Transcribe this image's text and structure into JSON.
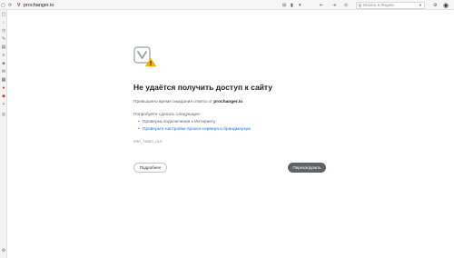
{
  "toolbar": {
    "url": "prochanger.io",
    "search_placeholder": "Искать в Яндекс"
  },
  "error": {
    "title": "Не удаётся получить доступ к сайту",
    "timeout_prefix": "Превышено время ожидания ответа от ",
    "host": "prochanger.io",
    "timeout_suffix": ".",
    "try_label": "Попробуйте сделать следующее:",
    "suggestions": [
      "Проверка подключения к Интернету",
      "Проверьте настройки прокси-сервера и брандмауэра"
    ],
    "code": "ERR_TIMED_OUT"
  },
  "buttons": {
    "details": "Подробнее",
    "reload": "Перезагрузить"
  },
  "colors": {
    "link": "#1a73e8",
    "reload_button": "#5f6368",
    "warning": "#f4b400"
  }
}
